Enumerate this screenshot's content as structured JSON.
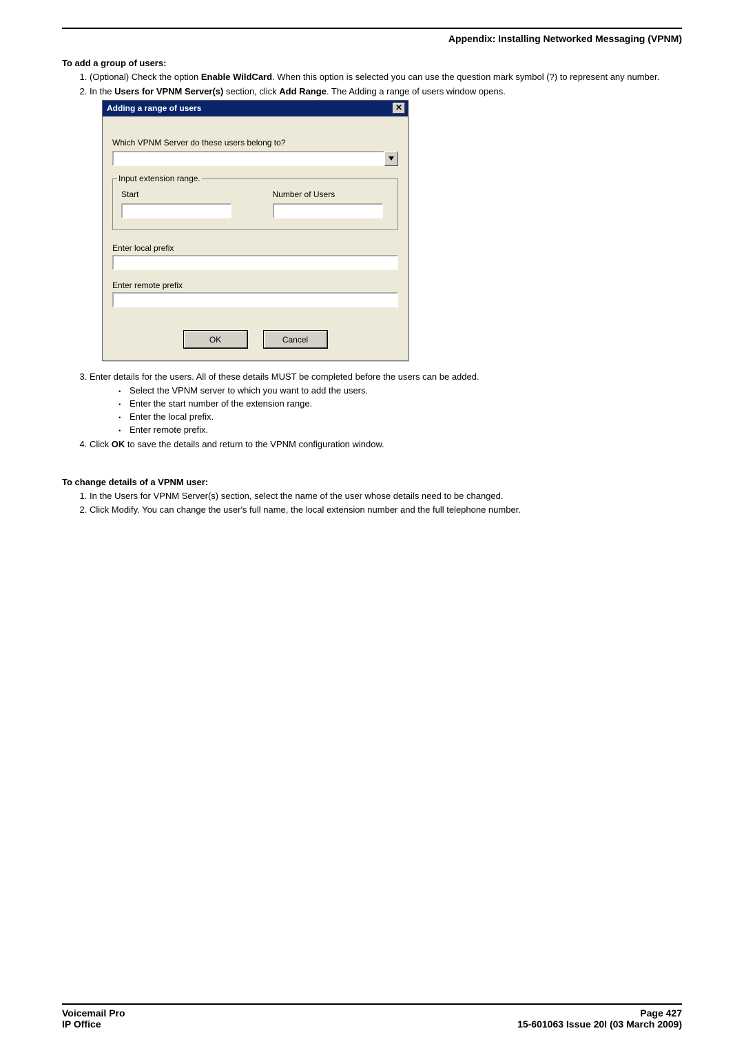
{
  "header": {
    "breadcrumb": "Appendix: Installing Networked Messaging (VPNM)"
  },
  "section1": {
    "heading": "To add a group of users:",
    "steps": {
      "s1_a": "(Optional) Check the option ",
      "s1_b": "Enable WildCard",
      "s1_c": ". When this option is selected you can use the question mark symbol (?) to represent any number.",
      "s2_a": "In the ",
      "s2_b": "Users for VPNM Server(s)",
      "s2_c": " section, click ",
      "s2_d": "Add Range",
      "s2_e": ". The Adding a range of users window opens.",
      "s3": "Enter details for the users. All of these details MUST be completed before the users can be added.",
      "s3_b1": "Select the VPNM server to which you want to add the users.",
      "s3_b2": "Enter the start number of the extension range.",
      "s3_b3": "Enter the local prefix.",
      "s3_b4": "Enter remote prefix.",
      "s4_a": "Click ",
      "s4_b": "OK",
      "s4_c": " to save the details and return to the VPNM configuration window."
    }
  },
  "dialog": {
    "title": "Adding a range of users",
    "server_label": "Which VPNM Server do these users belong to?",
    "fieldset_legend": "Input extension range.",
    "start_label": "Start",
    "num_users_label": "Number of Users",
    "local_prefix_label": "Enter local prefix",
    "remote_prefix_label": "Enter remote prefix",
    "ok": "OK",
    "cancel": "Cancel"
  },
  "section2": {
    "heading": "To change details of a VPNM user:",
    "s1": "In the Users for VPNM Server(s) section, select the name of the user whose details need to be changed.",
    "s2": "Click Modify. You can change the user's full name, the local extension number and the full telephone number."
  },
  "footer": {
    "left1": "Voicemail Pro",
    "left2": "IP Office",
    "right1": "Page 427",
    "right2": "15-601063 Issue 20l (03 March 2009)"
  }
}
